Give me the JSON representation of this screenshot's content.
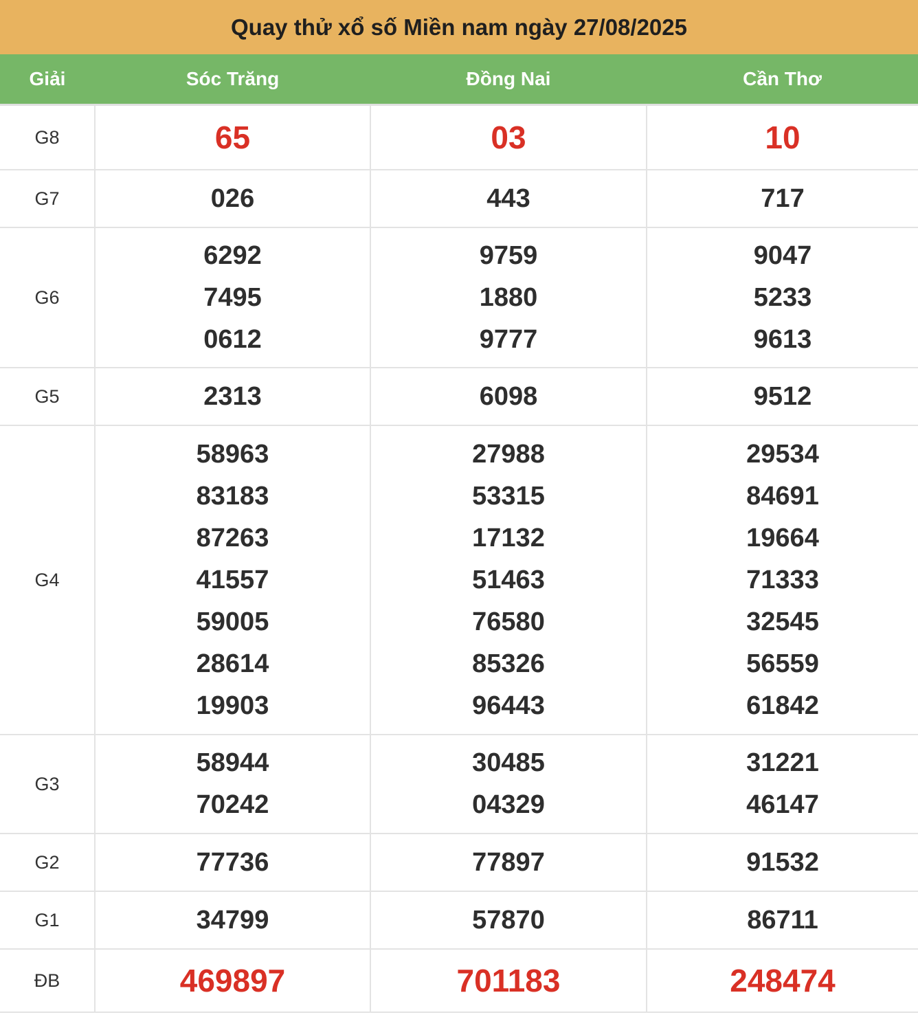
{
  "title": "Quay thử xổ số Miền nam ngày 27/08/2025",
  "headers": {
    "label": "Giải",
    "provinces": [
      "Sóc Trăng",
      "Đồng Nai",
      "Cần Thơ"
    ]
  },
  "rows": {
    "g8": {
      "label": "G8",
      "values": [
        [
          "65"
        ],
        [
          "03"
        ],
        [
          "10"
        ]
      ]
    },
    "g7": {
      "label": "G7",
      "values": [
        [
          "026"
        ],
        [
          "443"
        ],
        [
          "717"
        ]
      ]
    },
    "g6": {
      "label": "G6",
      "values": [
        [
          "6292",
          "7495",
          "0612"
        ],
        [
          "9759",
          "1880",
          "9777"
        ],
        [
          "9047",
          "5233",
          "9613"
        ]
      ]
    },
    "g5": {
      "label": "G5",
      "values": [
        [
          "2313"
        ],
        [
          "6098"
        ],
        [
          "9512"
        ]
      ]
    },
    "g4": {
      "label": "G4",
      "values": [
        [
          "58963",
          "83183",
          "87263",
          "41557",
          "59005",
          "28614",
          "19903"
        ],
        [
          "27988",
          "53315",
          "17132",
          "51463",
          "76580",
          "85326",
          "96443"
        ],
        [
          "29534",
          "84691",
          "19664",
          "71333",
          "32545",
          "56559",
          "61842"
        ]
      ]
    },
    "g3": {
      "label": "G3",
      "values": [
        [
          "58944",
          "70242"
        ],
        [
          "30485",
          "04329"
        ],
        [
          "31221",
          "46147"
        ]
      ]
    },
    "g2": {
      "label": "G2",
      "values": [
        [
          "77736"
        ],
        [
          "77897"
        ],
        [
          "91532"
        ]
      ]
    },
    "g1": {
      "label": "G1",
      "values": [
        [
          "34799"
        ],
        [
          "57870"
        ],
        [
          "86711"
        ]
      ]
    },
    "db": {
      "label": "ĐB",
      "values": [
        [
          "469897"
        ],
        [
          "701183"
        ],
        [
          "248474"
        ]
      ]
    }
  },
  "colors": {
    "title_bg": "#e8b35f",
    "header_bg": "#76b767",
    "highlight_red": "#d93025"
  }
}
